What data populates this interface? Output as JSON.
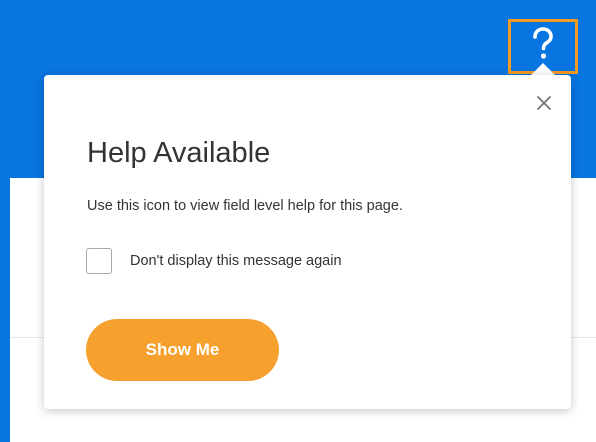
{
  "header": {
    "help_icon": "question-mark-icon"
  },
  "popover": {
    "close_icon": "close-icon",
    "title": "Help Available",
    "message": "Use this icon to view field level help for this page.",
    "checkbox": {
      "label": "Don't display this message again",
      "checked": false
    },
    "show_me_button": {
      "label": "Show Me"
    }
  },
  "colors": {
    "header_blue": "#0875e1",
    "highlight_orange": "#f29b22",
    "button_orange": "#f6a02d",
    "text_dark": "#333333"
  }
}
